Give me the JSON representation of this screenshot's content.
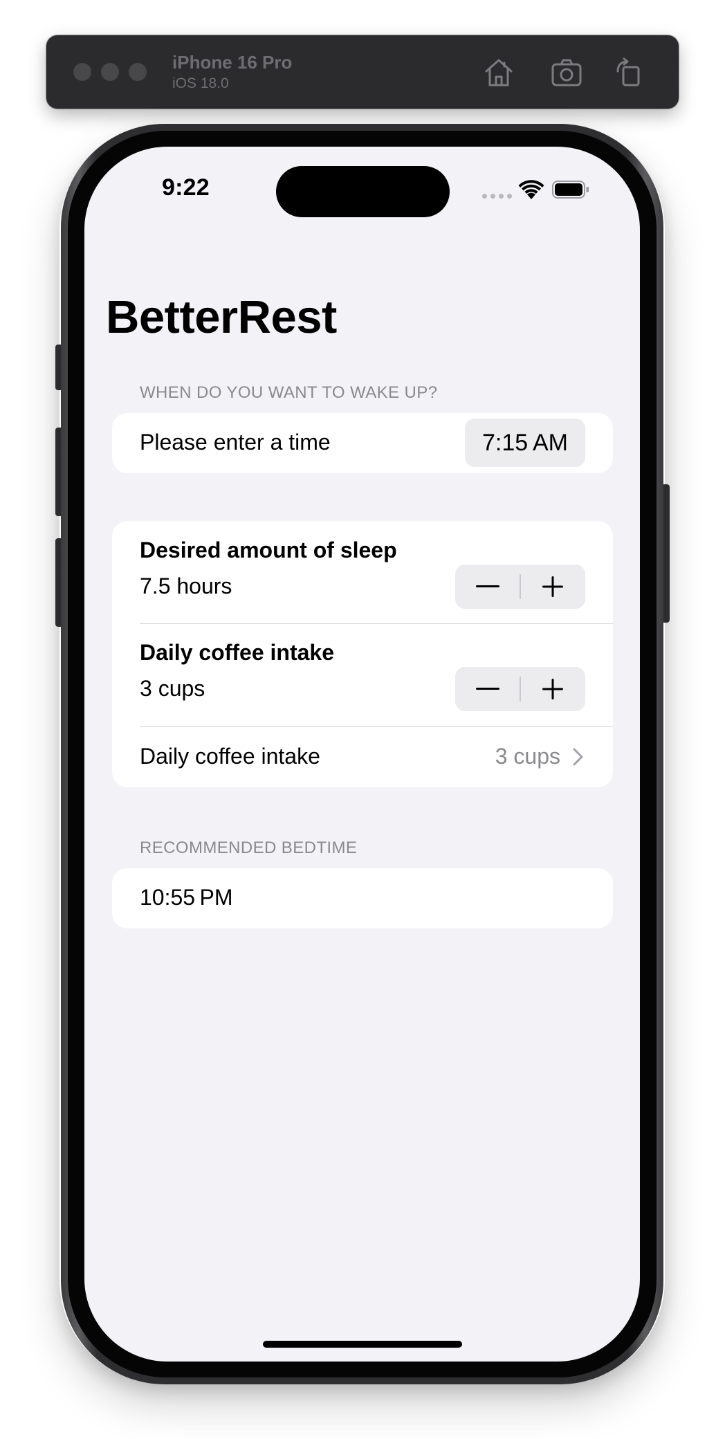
{
  "simulator": {
    "device_name": "iPhone 16 Pro",
    "os_version": "iOS 18.0",
    "icons": [
      "home-icon",
      "screenshot-icon",
      "rotate-icon"
    ]
  },
  "status_bar": {
    "time": "9:22",
    "icons": [
      "cellular-icon",
      "wifi-icon",
      "battery-icon"
    ]
  },
  "nav": {
    "title": "BetterRest"
  },
  "wake_section": {
    "header": "WHEN DO YOU WANT TO WAKE UP?",
    "label": "Please enter a time",
    "time_value": "7:15 AM"
  },
  "sleep_section": {
    "sleep": {
      "title": "Desired amount of sleep",
      "value": "7.5 hours",
      "decrement": "−",
      "increment": "+"
    },
    "coffee_stepper": {
      "title": "Daily coffee intake",
      "value": "3 cups",
      "decrement": "−",
      "increment": "+"
    },
    "coffee_picker": {
      "label": "Daily coffee intake",
      "value": "3 cups"
    }
  },
  "bedtime_section": {
    "header": "RECOMMENDED BEDTIME",
    "value": "10:55 PM"
  },
  "colors": {
    "screen_background": "#f2f2f7",
    "card_background": "#ffffff",
    "secondary_text": "#8a8a8e",
    "toolbar_background": "#2b2b2d"
  }
}
